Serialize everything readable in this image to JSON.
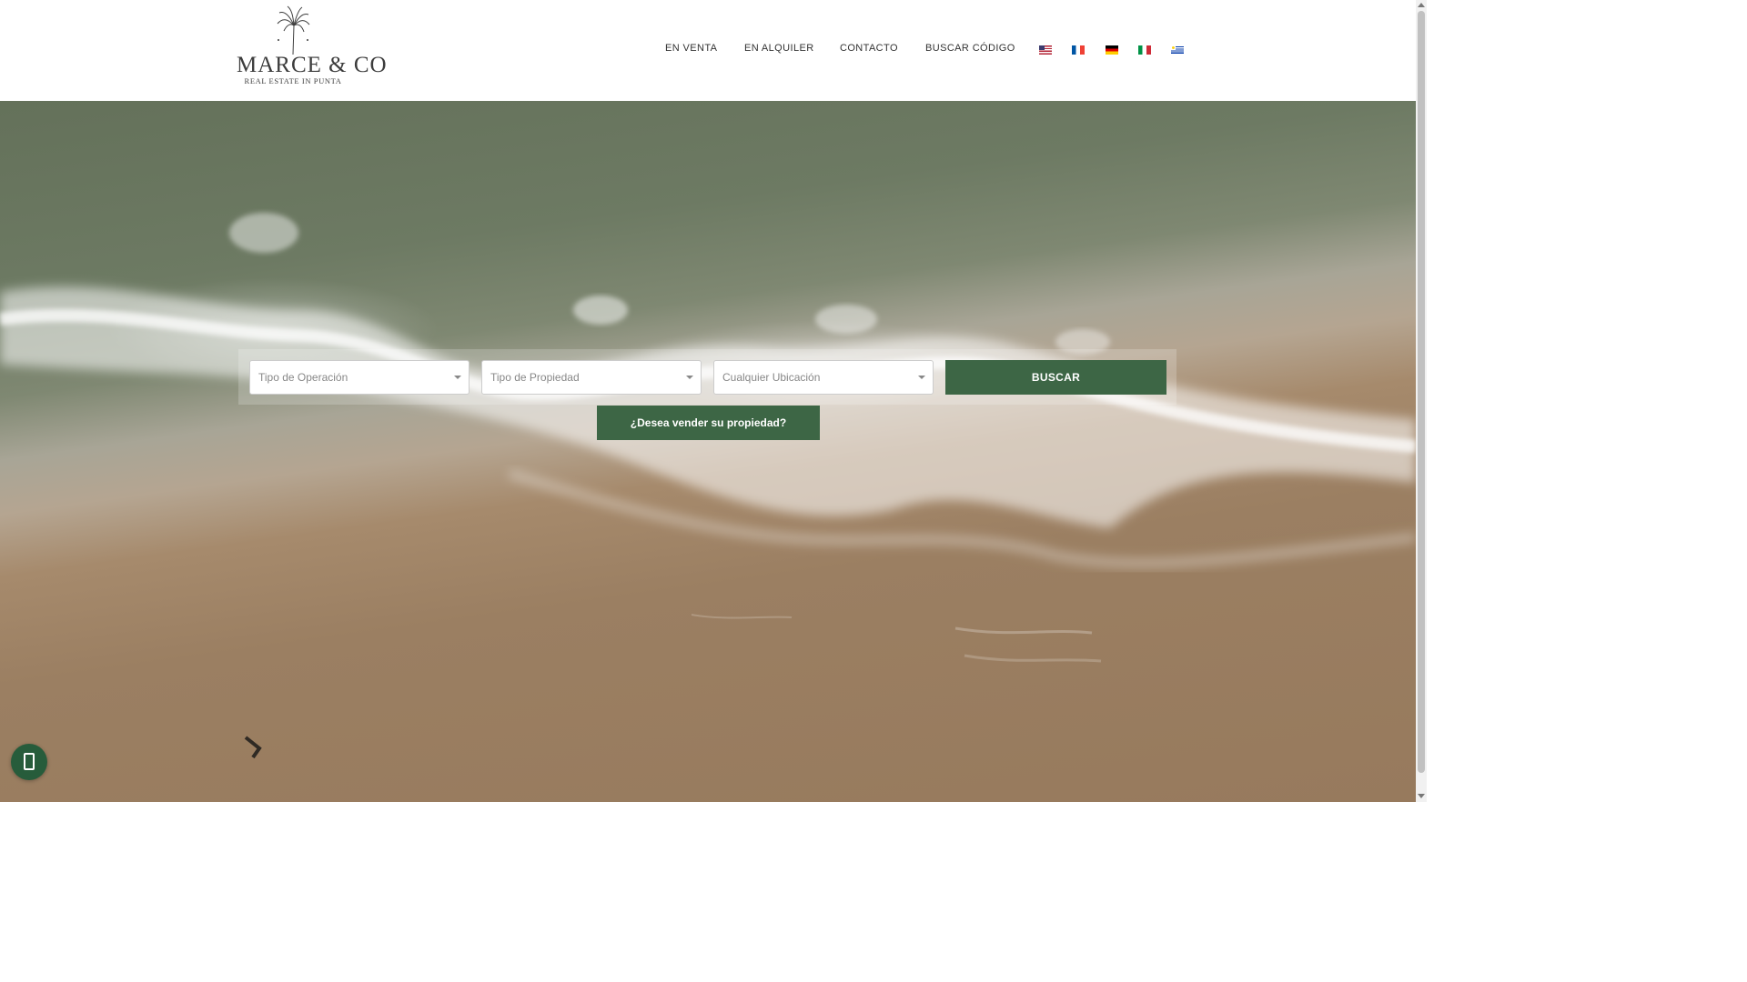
{
  "header": {
    "logo": {
      "brand": "MARCE & CO",
      "tagline": "REAL ESTATE IN PUNTA"
    },
    "nav": [
      {
        "label": "EN VENTA"
      },
      {
        "label": "EN ALQUILER"
      },
      {
        "label": "CONTACTO"
      },
      {
        "label": " BUSCAR CÓDIGO",
        "icon": "search-icon"
      }
    ],
    "languages": [
      {
        "code": "en",
        "icon": "flag-us-icon"
      },
      {
        "code": "fr",
        "icon": "flag-fr-icon"
      },
      {
        "code": "de",
        "icon": "flag-de-icon"
      },
      {
        "code": "it",
        "icon": "flag-it-icon"
      },
      {
        "code": "es",
        "icon": "flag-uy-icon"
      }
    ]
  },
  "search": {
    "operation_placeholder": "Tipo de Operación",
    "property_placeholder": "Tipo de Propiedad",
    "location_placeholder": "Cualquier Ubicación",
    "submit_label": "BUSCAR"
  },
  "sell_cta": {
    "label": "¿Desea vender su propiedad?"
  },
  "whatsapp": {
    "icon": "whatsapp-icon"
  },
  "colors": {
    "accent": "#3d6645",
    "whatsapp": "#275c3b"
  }
}
